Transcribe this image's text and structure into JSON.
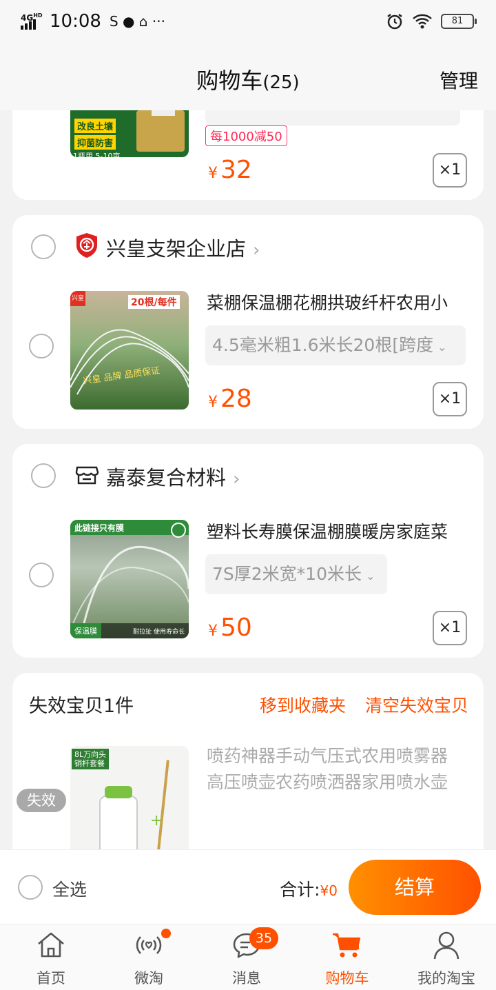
{
  "status_bar": {
    "network": "4G",
    "net_sup": "HD",
    "time": "10:08",
    "icons": "S ● ⌂ ···",
    "battery": "81"
  },
  "header": {
    "title": "购物车",
    "count": "(25)",
    "manage": "管理"
  },
  "cart_item_top": {
    "promo": "每1000减50",
    "price": "32",
    "yen": "¥",
    "qty": "×1",
    "thumb_text": [
      "改良土壤",
      "抑菌防害",
      "1瓶用 5-10亩"
    ]
  },
  "shops": [
    {
      "name": "兴皇支架企业店",
      "chevron": "›",
      "item": {
        "title": "菜棚保温棚花棚拱玻纤杆农用小",
        "sku": "4.5毫米粗1.6米长20根[跨度",
        "price": "28",
        "yen": "¥",
        "qty": "×1",
        "thumb_text": [
          "20根/每件",
          "兴皇 品牌 品质保证"
        ]
      }
    },
    {
      "name": "嘉泰复合材料",
      "chevron": "›",
      "item": {
        "title": "塑料长寿膜保温棚膜暖房家庭菜",
        "sku": "7S厚2米宽*10米长",
        "price": "50",
        "yen": "¥",
        "qty": "×1",
        "thumb_text": [
          "此链接只有膜",
          "保温膜",
          "耐拉扯 使用寿命长"
        ]
      }
    }
  ],
  "invalid": {
    "header": "失效宝贝1件",
    "move_to_fav": "移到收藏夹",
    "clear": "清空失效宝贝",
    "badge": "失效",
    "title_line1": "喷药神器手动气压式农用喷雾器",
    "title_line2": "高压喷壶农药喷洒器家用喷水壶",
    "thumb_text": [
      "8L万向头",
      "铜杆套餐"
    ]
  },
  "checkout": {
    "select_all": "全选",
    "total_label": "合计:",
    "total_value": "¥0",
    "button": "结算"
  },
  "tabs": [
    {
      "label": "首页",
      "icon": "home-icon"
    },
    {
      "label": "微淘",
      "icon": "broadcast-icon"
    },
    {
      "label": "消息",
      "icon": "chat-icon",
      "badge": "35"
    },
    {
      "label": "购物车",
      "icon": "cart-icon"
    },
    {
      "label": "我的淘宝",
      "icon": "person-icon"
    }
  ],
  "colors": {
    "accent": "#ff5000",
    "active_tab": "#ff5000",
    "page_bg": "#f2f2f2"
  }
}
